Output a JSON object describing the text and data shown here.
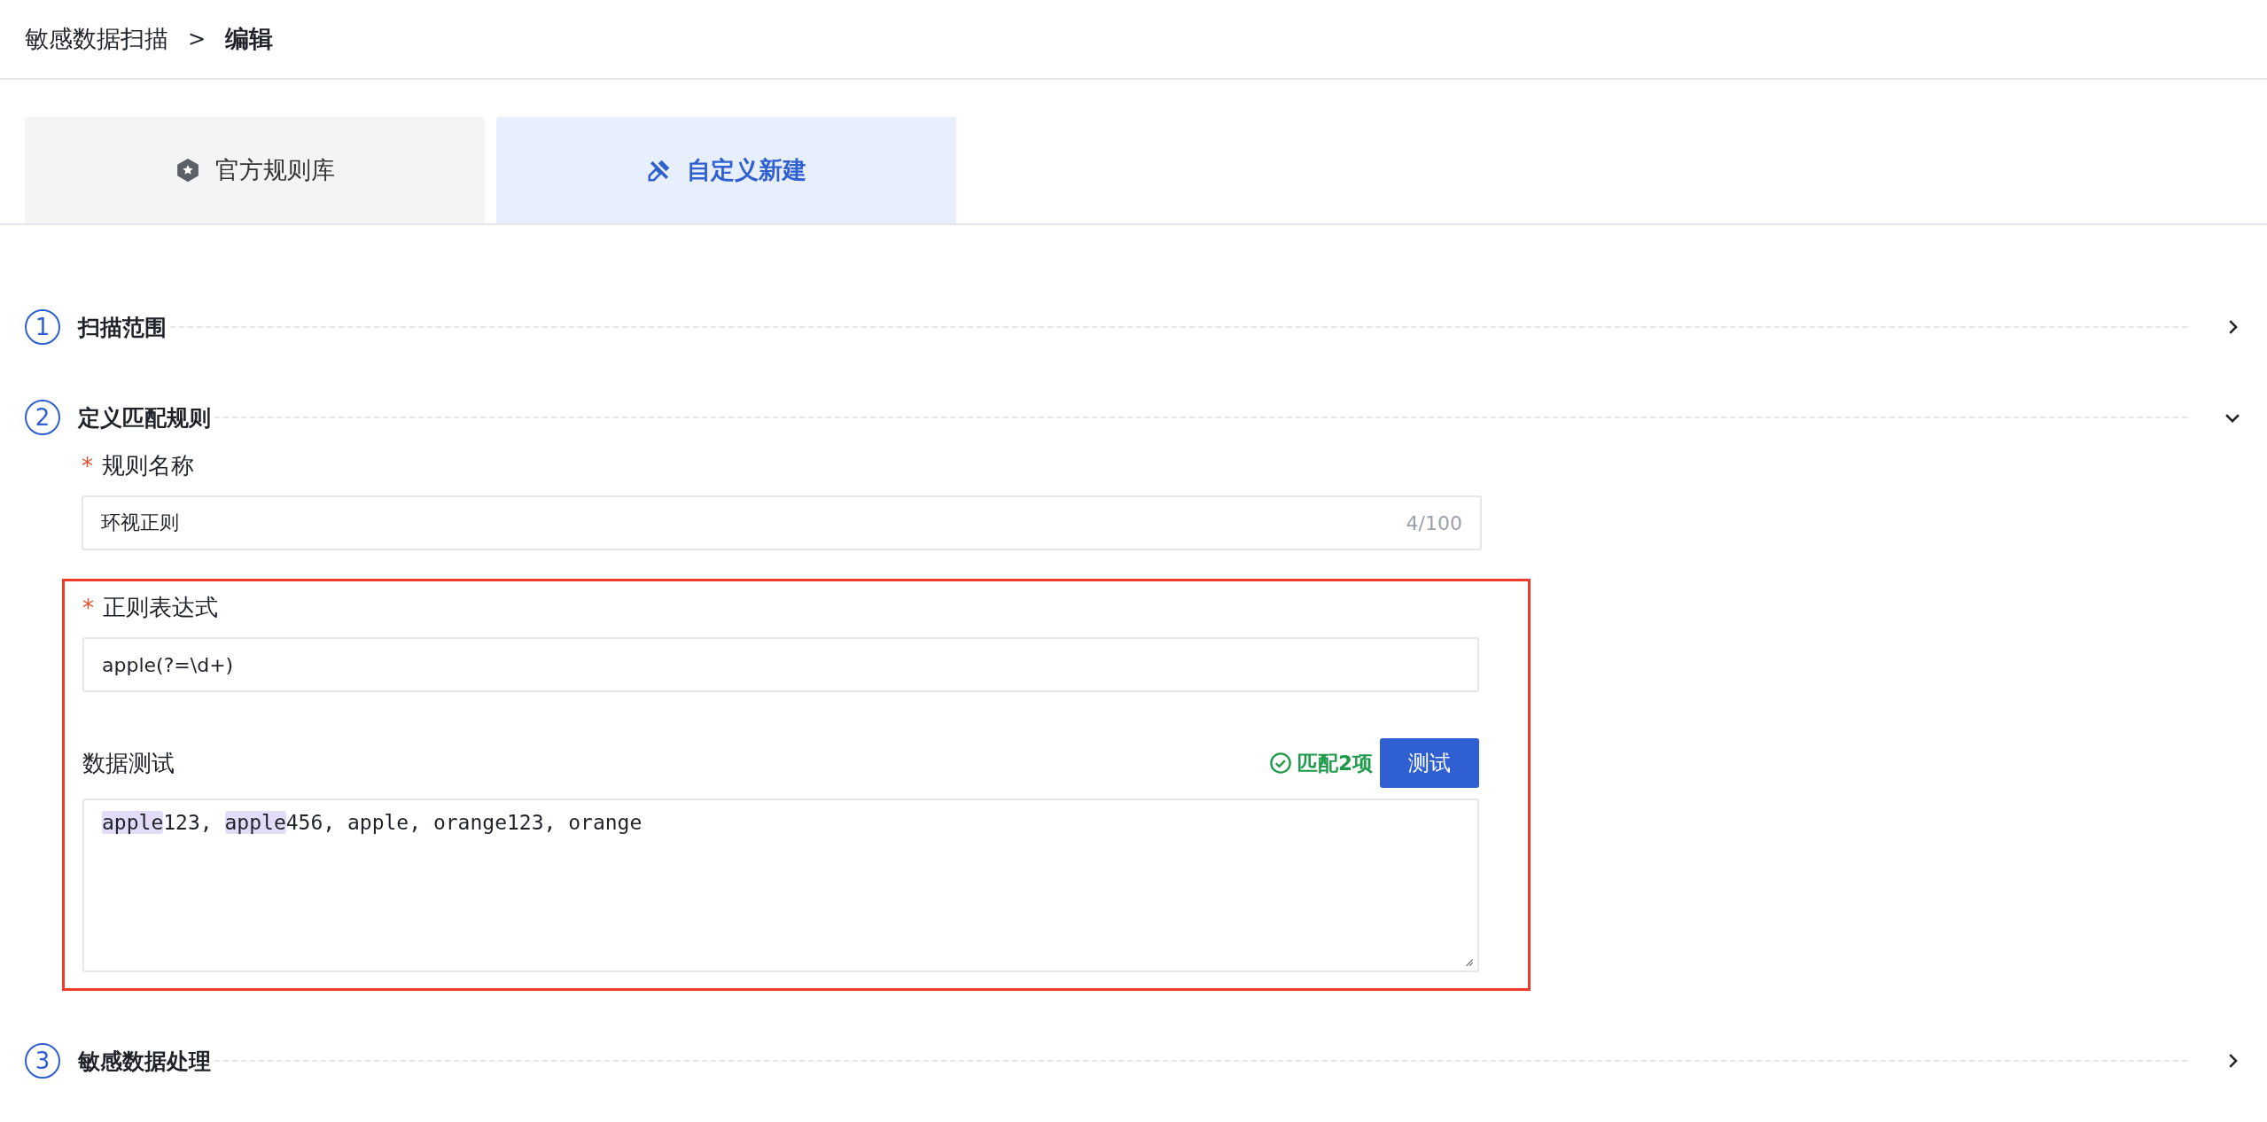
{
  "breadcrumb": {
    "parent": "敏感数据扫描",
    "separator": ">",
    "current": "编辑"
  },
  "tabs": [
    {
      "label": "官方规则库",
      "selected": false
    },
    {
      "label": "自定义新建",
      "selected": true
    }
  ],
  "steps": [
    {
      "number": "1",
      "title": "扫描范围",
      "expanded": false
    },
    {
      "number": "2",
      "title": "定义匹配规则",
      "expanded": true,
      "form": {
        "name_field": {
          "label": "规则名称",
          "required_mark": "*",
          "value": "环视正则",
          "counter": "4/100"
        },
        "regex_group": {
          "outlined": true,
          "regex_field": {
            "label": "正则表达式",
            "required_mark": "*",
            "value": "apple(?=\\d+)"
          },
          "test": {
            "label": "数据测试",
            "match_status": "匹配2项",
            "button": "测试",
            "segments": [
              {
                "text": "apple",
                "highlighted": true
              },
              {
                "text": "123, ",
                "highlighted": false
              },
              {
                "text": "apple",
                "highlighted": true
              },
              {
                "text": "456, apple, orange123, orange",
                "highlighted": false
              }
            ]
          }
        }
      }
    },
    {
      "number": "3",
      "title": "敏感数据处理",
      "expanded": false
    }
  ]
}
